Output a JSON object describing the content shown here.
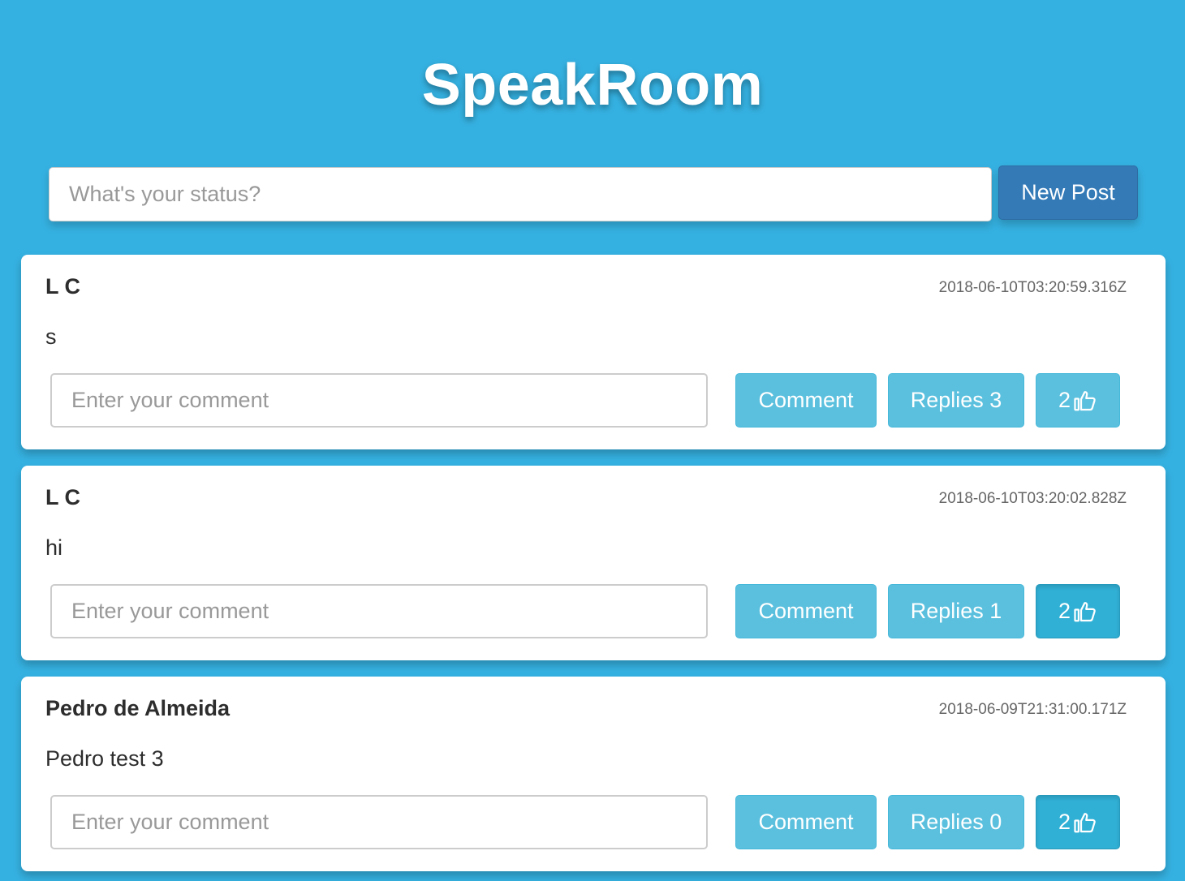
{
  "app": {
    "title": "SpeakRoom"
  },
  "composer": {
    "placeholder": "What's your status?",
    "new_post_label": "New Post"
  },
  "posts": [
    {
      "author": "L C",
      "timestamp": "2018-06-10T03:20:59.316Z",
      "body": "s",
      "comment_placeholder": "Enter your comment",
      "comment_label": "Comment",
      "replies_label": "Replies 3",
      "likes": "2",
      "liked": false
    },
    {
      "author": "L C",
      "timestamp": "2018-06-10T03:20:02.828Z",
      "body": "hi",
      "comment_placeholder": "Enter your comment",
      "comment_label": "Comment",
      "replies_label": "Replies 1",
      "likes": "2",
      "liked": true
    },
    {
      "author": "Pedro de Almeida",
      "timestamp": "2018-06-09T21:31:00.171Z",
      "body": "Pedro test 3",
      "comment_placeholder": "Enter your comment",
      "comment_label": "Comment",
      "replies_label": "Replies 0",
      "likes": "2",
      "liked": true
    }
  ],
  "icons": {
    "like": "thumbs-up-icon"
  },
  "colors": {
    "background": "#35b1e1",
    "primary": "#337ab7",
    "info": "#5bc0de",
    "info_active": "#31b0d5"
  }
}
